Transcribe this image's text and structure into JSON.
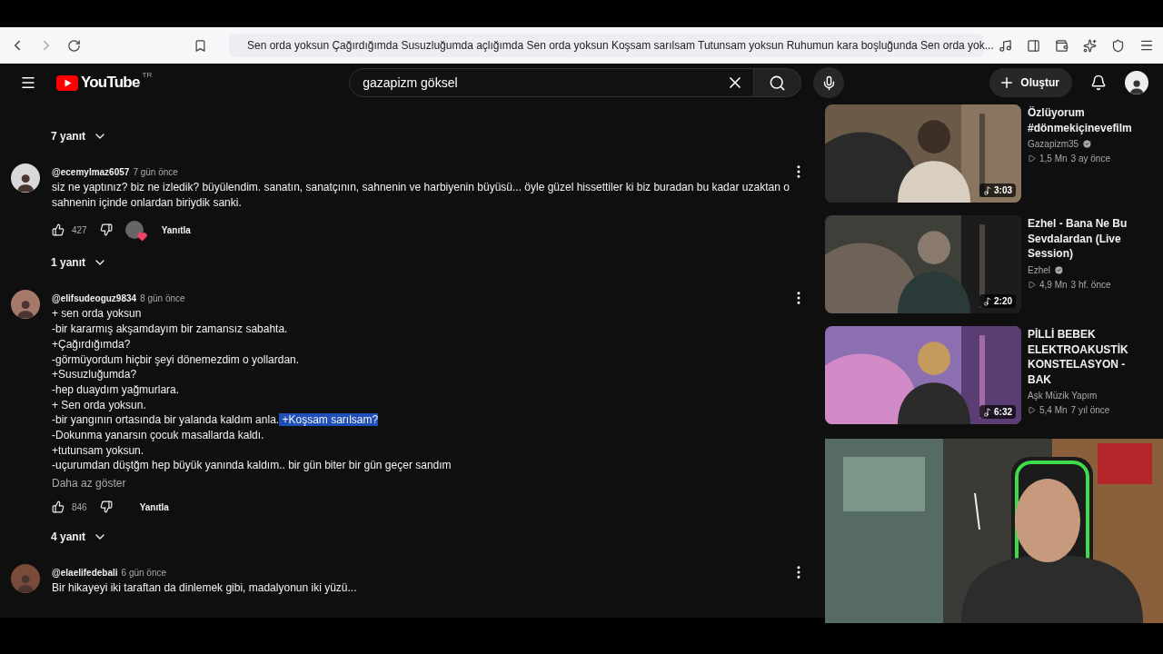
{
  "browser": {
    "address": "Sen orda yoksun Çağırdığımda Susuzluğumda açlığımda Sen orda yoksun Koşsam sarılsam Tutunsam yoksun Ruhumun kara boşluğunda Sen orda yok..."
  },
  "header": {
    "logo": "YouTube",
    "region": "TR",
    "search": {
      "value": "gazapizm göksel"
    },
    "create_label": "Oluştur"
  },
  "thread": [
    {
      "kind": "replies",
      "label": "7 yanıt"
    },
    {
      "kind": "comment",
      "author": "@ecemylmaz6057",
      "time": "7 gün önce",
      "lines": [
        {
          "text": "siz ne yaptınız? biz ne izledik? büyülendim. sanatın, sanatçının, sahnenin ve harbiyenin büyüsü... öyle güzel hissettiler ki biz buradan bu kadar uzaktan o sahnenin içinde onlardan biriydik sanki."
        }
      ],
      "likes": "427",
      "hearted": true,
      "reply_label": "Yanıtla"
    },
    {
      "kind": "replies",
      "label": "1 yanıt"
    },
    {
      "kind": "comment",
      "author": "@elifsudeoguz9834",
      "time": "8 gün önce",
      "lines": [
        {
          "text": "+ sen orda yoksun"
        },
        {
          "text": "-bir kararmış akşamdayım bir zamansız sabahta."
        },
        {
          "text": "+Çağırdığımda?"
        },
        {
          "text": "-görmüyordum hiçbir şeyi dönemezdim o yollardan."
        },
        {
          "text": "+Susuzluğumda?"
        },
        {
          "text": "-hep duaydım yağmurlara."
        },
        {
          "text": "+ Sen orda yoksun."
        },
        {
          "text": "-bir yangının ortasında bir yalanda kaldım anla.",
          "selected_text": " +Koşsam sarılsam?"
        },
        {
          "text": "-Dokunma yanarsın çocuk masallarda kaldı."
        },
        {
          "text": "+tutunsam yoksun."
        },
        {
          "text": "-uçurumdan düştğm hep büyük  yanında kaldım.. bir gün biter bir gün geçer sandım"
        }
      ],
      "show_less": "Daha az göster",
      "likes": "846",
      "hearted": false,
      "reply_label": "Yanıtla"
    },
    {
      "kind": "replies",
      "label": "4 yanıt"
    },
    {
      "kind": "comment",
      "author": "@elaelifedebali",
      "time": "6 gün önce",
      "lines": [
        {
          "text": "Bir hikayeyi iki taraftan da dinlemek gibi, madalyonun iki yüzü..."
        }
      ]
    }
  ],
  "videos": [
    {
      "title": "Özlüyorum #dönmekiçinevefilm",
      "channel": "Gazapizm35",
      "verified": true,
      "views": "1,5 Mn",
      "age": "3 ay önce",
      "duration": "3:03"
    },
    {
      "title": "Ezhel - Bana Ne Bu Sevdalardan (Live Session)",
      "channel": "Ezhel",
      "verified": true,
      "views": "4,9 Mn",
      "age": "3 hf. önce",
      "duration": "2:20"
    },
    {
      "title": "PİLLİ BEBEK ELEKTROAKUSTİK KONSTELASYON - BAK",
      "channel": "Aşk Müzik Yapım",
      "verified": false,
      "views": "5,4 Mn",
      "age": "7 yıl önce",
      "duration": "6:32"
    }
  ]
}
